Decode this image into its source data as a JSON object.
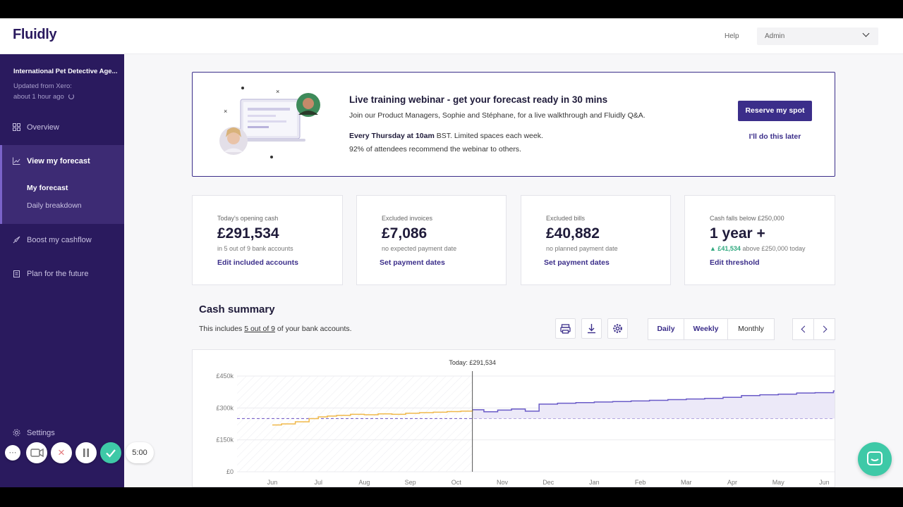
{
  "app": {
    "logo": "Fluidly"
  },
  "topbar": {
    "help": "Help",
    "user": "Admin"
  },
  "sidebar": {
    "org": "International Pet Detective Age...",
    "updated_line1": "Updated from Xero:",
    "updated_line2": "about 1 hour ago",
    "items": [
      {
        "label": "Overview",
        "icon": "grid-icon"
      },
      {
        "label": "View my forecast",
        "icon": "line-chart-icon"
      },
      {
        "label": "Boost my cashflow",
        "icon": "rocket-icon"
      },
      {
        "label": "Plan for the future",
        "icon": "clipboard-icon"
      },
      {
        "label": "Settings",
        "icon": "gear-icon"
      }
    ],
    "subitems": [
      "My forecast",
      "Daily breakdown"
    ]
  },
  "recorder": {
    "timer": "5:00"
  },
  "banner": {
    "title": "Live training webinar - get your forecast ready in 30 mins",
    "subtitle": "Join our Product Managers, Sophie and Stéphane, for a live walkthrough and Fluidly Q&A.",
    "line1_bold": "Every Thursday at 10am",
    "line1_rest": " BST. Limited spaces each week.",
    "line2": "92% of attendees recommend the webinar to others.",
    "primary": "Reserve my spot",
    "secondary": "I'll do this later"
  },
  "cards": [
    {
      "label": "Today's opening cash",
      "value": "£291,534",
      "note": "in 5 out of 9 bank accounts",
      "link": "Edit included accounts"
    },
    {
      "label": "Excluded invoices",
      "value": "£7,086",
      "note": "no expected payment date",
      "link": "Set payment dates"
    },
    {
      "label": "Excluded bills",
      "value": "£40,882",
      "note": "no planned payment date",
      "link": "Set payment dates"
    },
    {
      "label": "Cash falls below £250,000",
      "value": "1 year +",
      "note_up": "▲ £41,534",
      "note": " above £250,000 today",
      "link": "Edit threshold"
    }
  ],
  "summary": {
    "title": "Cash summary",
    "sub_pre": "This includes ",
    "sub_link": "5 out of 9",
    "sub_post": " of your bank accounts.",
    "views": [
      "Daily",
      "Weekly",
      "Monthly"
    ],
    "active_view": "Daily"
  },
  "colors": {
    "brand": "#2a1a5e",
    "accent": "#3b2e8a",
    "actual": "#f0b84a",
    "forecast": "#6a5bc8",
    "threshold": "#7a63c9",
    "teal": "#3ec9a7"
  },
  "chart_data": {
    "type": "line",
    "today_label": "Today: £291,534",
    "y_ticks": [
      "£450k",
      "£300k",
      "£150k",
      "£0"
    ],
    "ylim": [
      0,
      450000
    ],
    "x_ticks": [
      "Jun",
      "Jul",
      "Aug",
      "Sep",
      "Oct",
      "Nov",
      "Dec",
      "Jan",
      "Feb",
      "Mar",
      "Apr",
      "May",
      "Jun"
    ],
    "threshold": 250000,
    "today_index": 4.35,
    "series": [
      {
        "kind": "actual",
        "x": [
          0,
          0.2,
          0.5,
          0.8,
          1.0,
          1.2,
          1.4,
          1.7,
          2.0,
          2.3,
          2.6,
          2.9,
          3.2,
          3.5,
          3.8,
          4.1,
          4.35
        ],
        "values": [
          220000,
          225000,
          235000,
          250000,
          258000,
          262000,
          265000,
          270000,
          268000,
          272000,
          270000,
          275000,
          278000,
          280000,
          283000,
          285000,
          291534
        ]
      },
      {
        "kind": "forecast",
        "x": [
          4.35,
          4.6,
          4.9,
          5.2,
          5.5,
          5.8,
          6.2,
          6.6,
          7.0,
          7.4,
          7.8,
          8.2,
          8.6,
          9.0,
          9.4,
          9.8,
          10.2,
          10.6,
          11.0,
          11.4,
          11.8,
          12.2
        ],
        "values": [
          291534,
          282000,
          290000,
          295000,
          285000,
          318000,
          322000,
          325000,
          328000,
          330000,
          333000,
          336000,
          339000,
          342000,
          345000,
          350000,
          358000,
          362000,
          365000,
          370000,
          372000,
          380000
        ]
      }
    ]
  }
}
